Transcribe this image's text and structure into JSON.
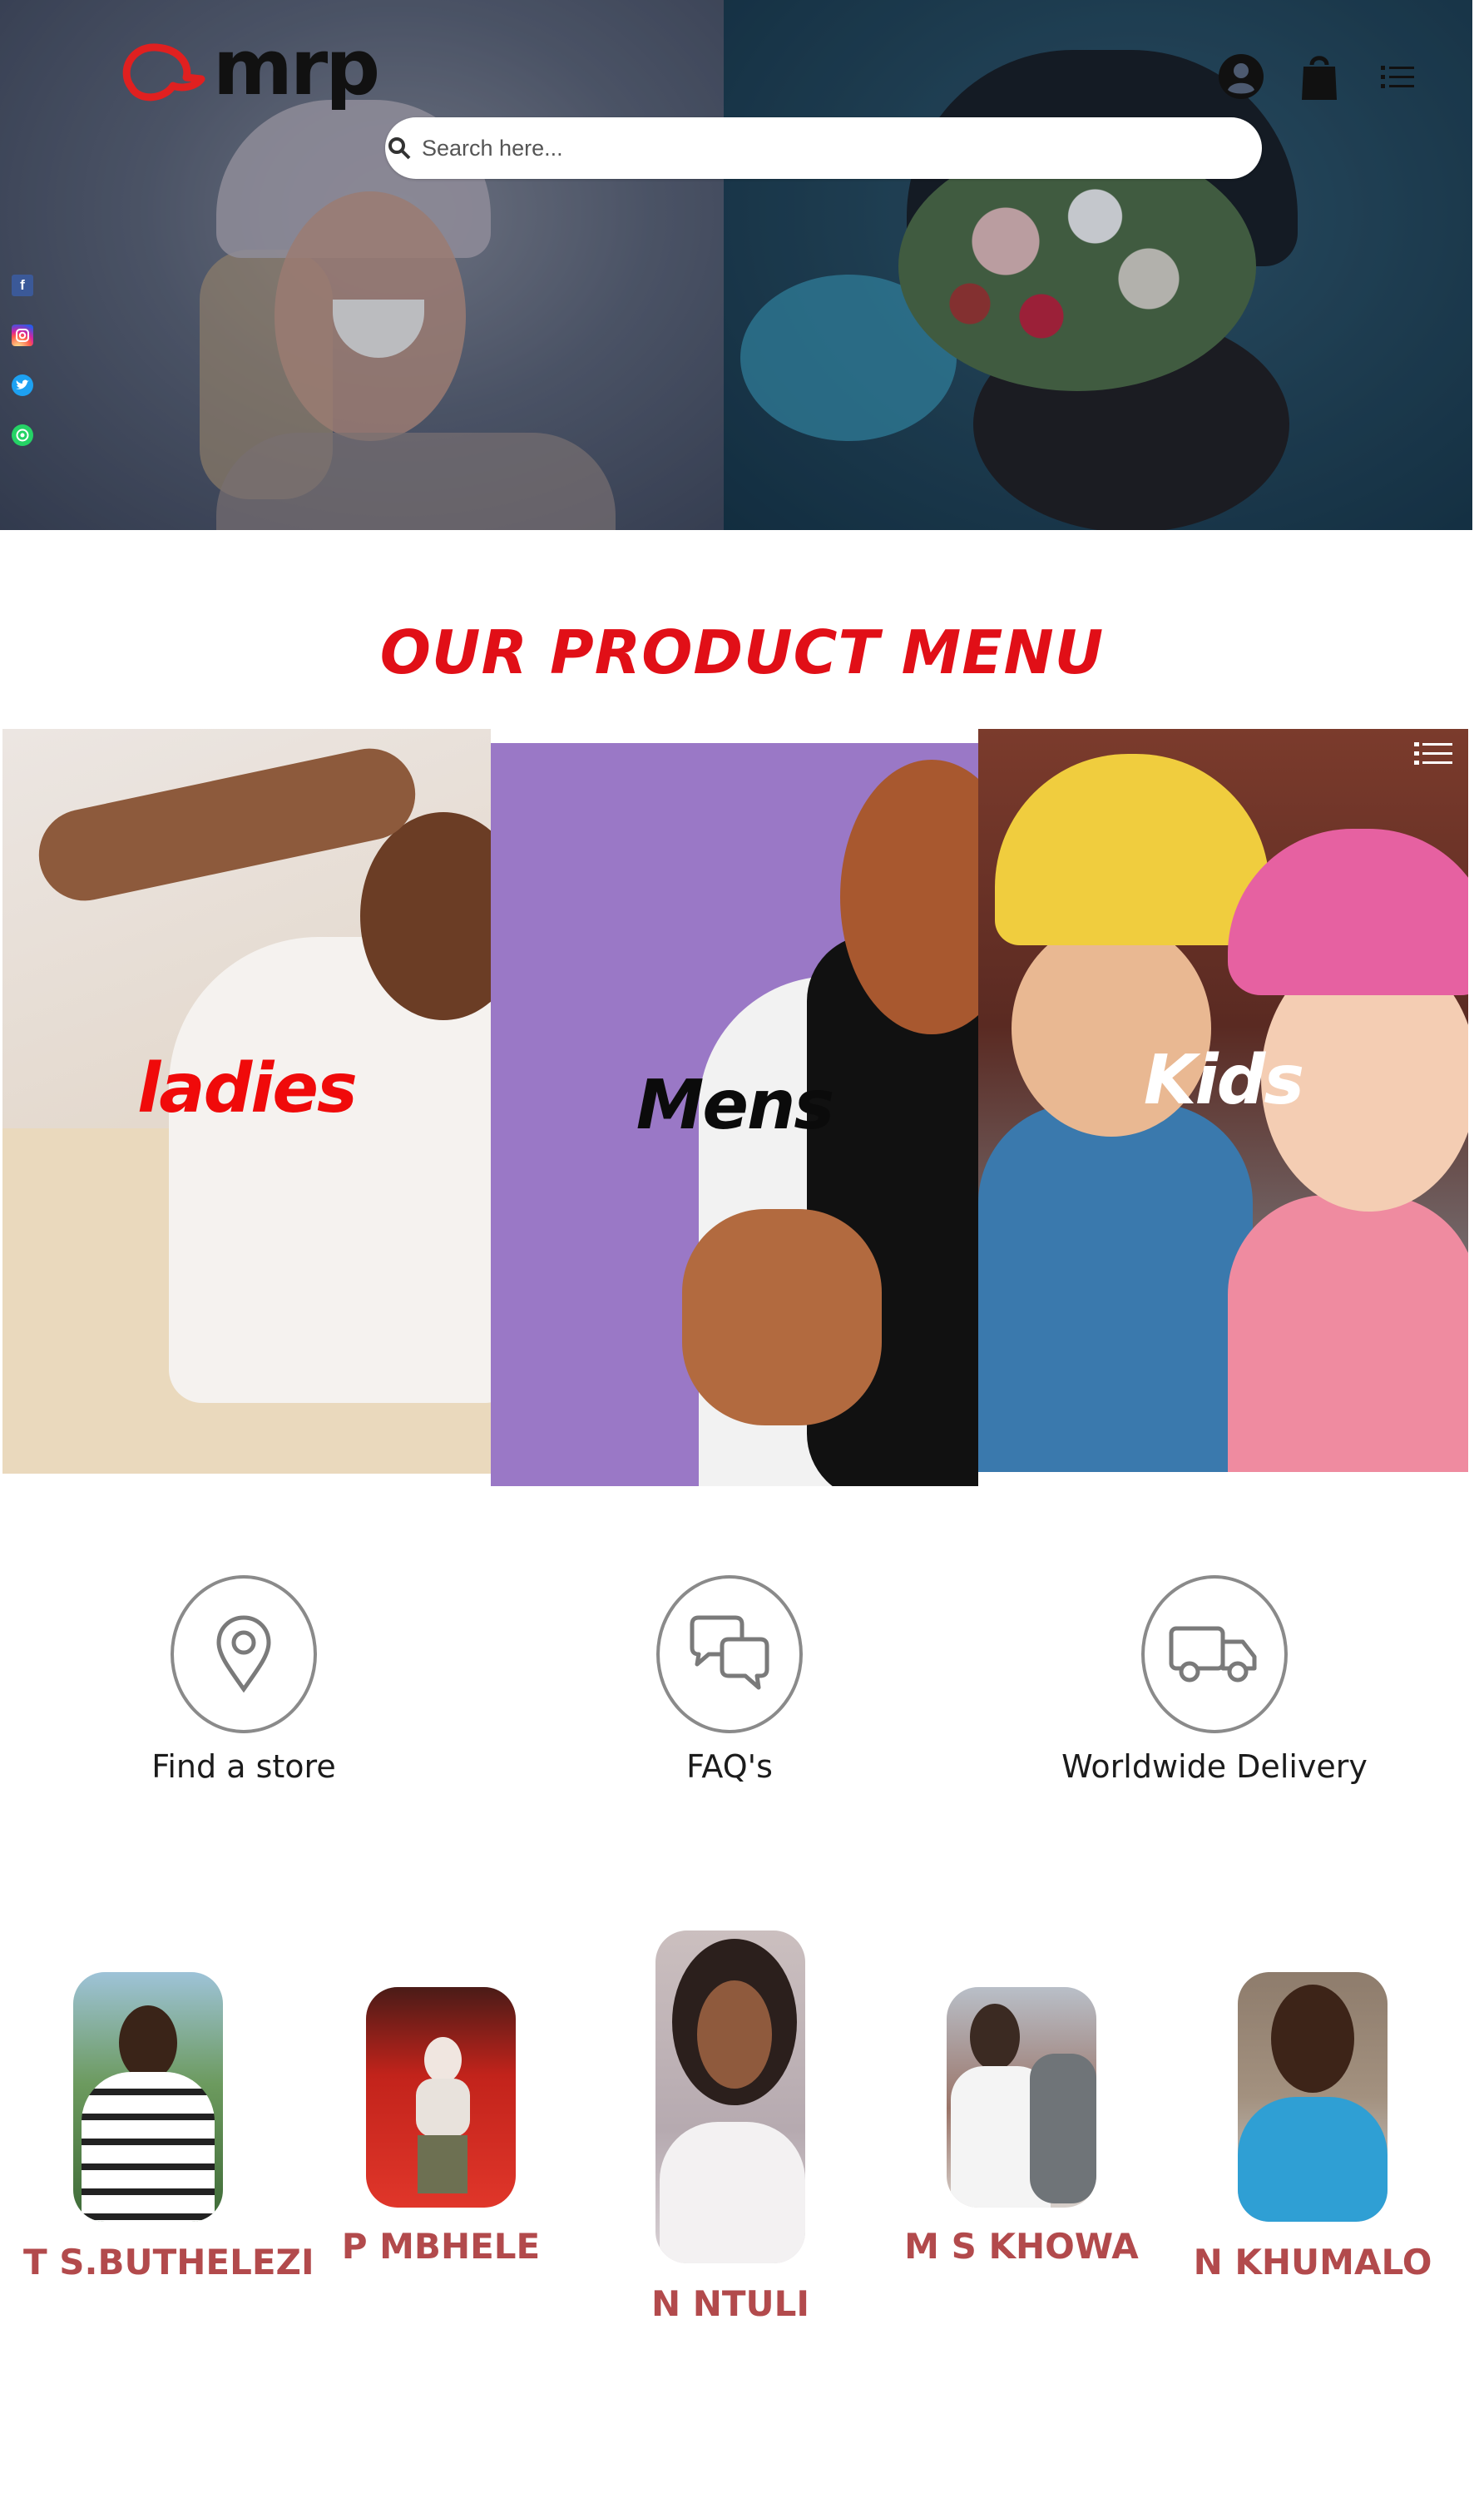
{
  "header": {
    "brand": "mrp",
    "search_placeholder": "Search here...",
    "icons": [
      "user-circle-icon",
      "shopping-bag-icon",
      "menu-list-icon"
    ]
  },
  "social": [
    "facebook-icon",
    "instagram-icon",
    "twitter-icon",
    "whatsapp-icon"
  ],
  "section_title": "OUR PRODUCT MENU",
  "categories": [
    {
      "label": "ladies",
      "color": "#f00a0a"
    },
    {
      "label": "Mens",
      "color": "#0b0b0b"
    },
    {
      "label": "Kids",
      "color": "#ffffff"
    }
  ],
  "features": [
    {
      "label": "Find a store",
      "icon": "map-pin-icon"
    },
    {
      "label": "FAQ's",
      "icon": "chat-bubbles-icon"
    },
    {
      "label": "Worldwide Delivery",
      "icon": "truck-icon"
    }
  ],
  "team": [
    {
      "name": "T S.BUTHELEZI"
    },
    {
      "name": "P MBHELE"
    },
    {
      "name": "N NTULI"
    },
    {
      "name": "M S KHOWA"
    },
    {
      "name": "N KHUMALO"
    }
  ],
  "colors": {
    "accent": "#e10f17",
    "team_name": "#b24a4c",
    "mens_bg": "#9a78c6"
  }
}
